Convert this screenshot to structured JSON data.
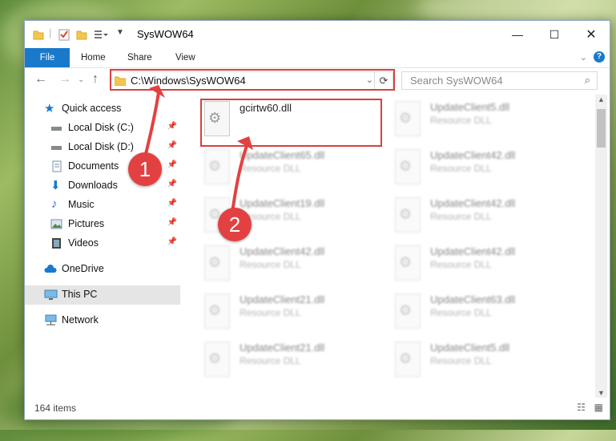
{
  "window": {
    "title": "SysWOW64"
  },
  "ribbon": {
    "file": "File",
    "tabs": [
      "Home",
      "Share",
      "View"
    ]
  },
  "address": {
    "path": "C:\\Windows\\SysWOW64"
  },
  "search": {
    "placeholder": "Search SysWOW64"
  },
  "sidebar": {
    "quick_access": "Quick access",
    "items": [
      {
        "label": "Local Disk (C:)",
        "icon": "drive-icon"
      },
      {
        "label": "Local Disk (D:)",
        "icon": "drive-icon"
      },
      {
        "label": "Documents",
        "icon": "documents-icon"
      },
      {
        "label": "Downloads",
        "icon": "downloads-icon"
      },
      {
        "label": "Music",
        "icon": "music-icon"
      },
      {
        "label": "Pictures",
        "icon": "pictures-icon"
      },
      {
        "label": "Videos",
        "icon": "videos-icon"
      }
    ],
    "onedrive": "OneDrive",
    "this_pc": "This PC",
    "network": "Network"
  },
  "files": {
    "highlighted": {
      "name": "gcirtw60.dll"
    },
    "col1": [
      {
        "name": "UpdateClient65.dll",
        "type": "Resource DLL"
      },
      {
        "name": "UpdateClient19.dll",
        "type": "Resource DLL"
      },
      {
        "name": "UpdateClient42.dll",
        "type": "Resource DLL"
      },
      {
        "name": "UpdateClient21.dll",
        "type": "Resource DLL"
      },
      {
        "name": "UpdateClient21.dll",
        "type": "Resource DLL"
      }
    ],
    "col2": [
      {
        "name": "UpdateClient5.dll",
        "type": "Resource DLL"
      },
      {
        "name": "UpdateClient42.dll",
        "type": "Resource DLL"
      },
      {
        "name": "UpdateClient42.dll",
        "type": "Resource DLL"
      },
      {
        "name": "UpdateClient42.dll",
        "type": "Resource DLL"
      },
      {
        "name": "UpdateClient63.dll",
        "type": "Resource DLL"
      },
      {
        "name": "UpdateClient5.dll",
        "type": "Resource DLL"
      }
    ]
  },
  "status": {
    "items_count": "164 items"
  },
  "callouts": [
    "1",
    "2"
  ],
  "colors": {
    "accent": "#1979ca",
    "callout": "#e34141",
    "highlight_box": "#d6403f"
  }
}
